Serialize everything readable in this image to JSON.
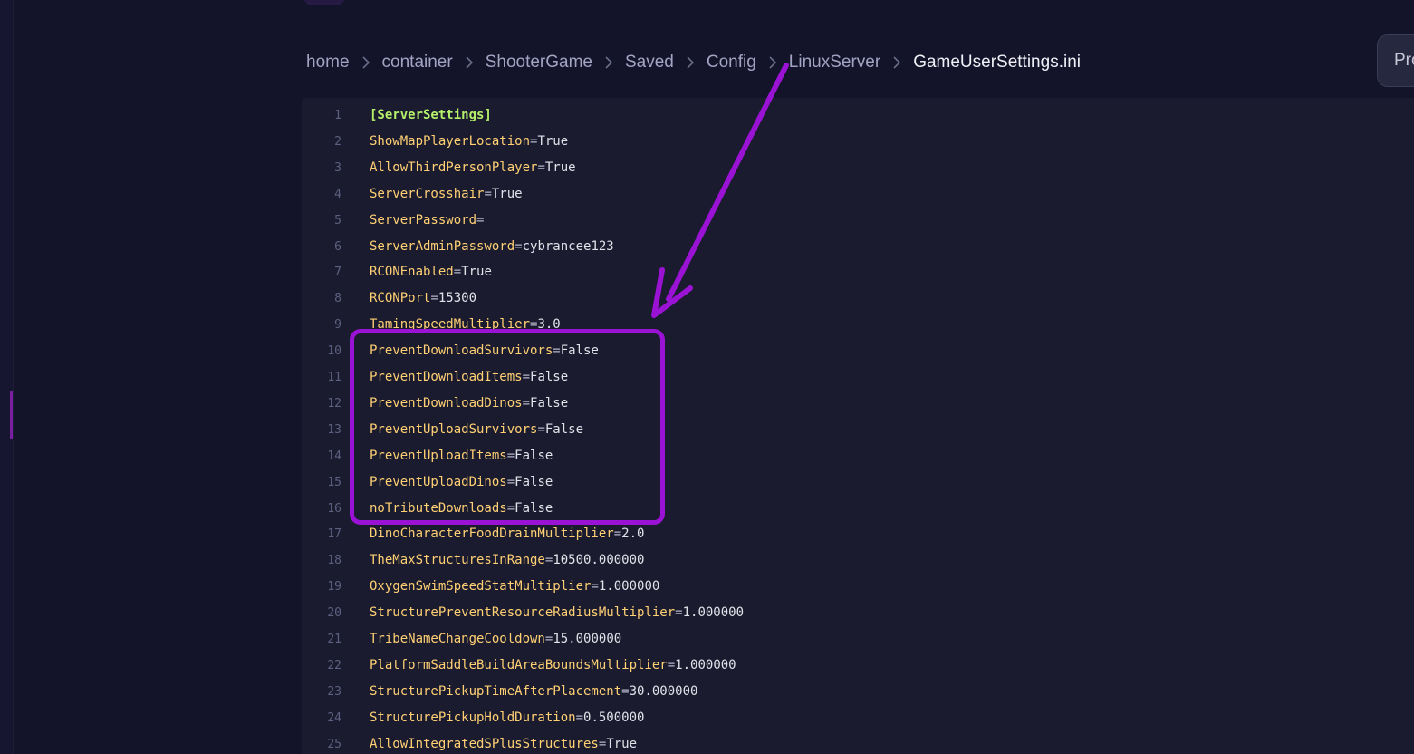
{
  "breadcrumb": {
    "items": [
      "home",
      "container",
      "ShooterGame",
      "Saved",
      "Config",
      "LinuxServer"
    ],
    "current": "GameUserSettings.ini"
  },
  "profile_button": {
    "label": "Pro"
  },
  "editor": {
    "lines": [
      {
        "n": "1",
        "section": "[ServerSettings]"
      },
      {
        "n": "2",
        "key": "ShowMapPlayerLocation",
        "value": "True"
      },
      {
        "n": "3",
        "key": "AllowThirdPersonPlayer",
        "value": "True"
      },
      {
        "n": "4",
        "key": "ServerCrosshair",
        "value": "True"
      },
      {
        "n": "5",
        "key": "ServerPassword",
        "value": ""
      },
      {
        "n": "6",
        "key": "ServerAdminPassword",
        "value": "cybrancee123"
      },
      {
        "n": "7",
        "key": "RCONEnabled",
        "value": "True"
      },
      {
        "n": "8",
        "key": "RCONPort",
        "value": "15300"
      },
      {
        "n": "9",
        "key": "TamingSpeedMultiplier",
        "value": "3.0"
      },
      {
        "n": "10",
        "key": "PreventDownloadSurvivors",
        "value": "False"
      },
      {
        "n": "11",
        "key": "PreventDownloadItems",
        "value": "False"
      },
      {
        "n": "12",
        "key": "PreventDownloadDinos",
        "value": "False"
      },
      {
        "n": "13",
        "key": "PreventUploadSurvivors",
        "value": "False"
      },
      {
        "n": "14",
        "key": "PreventUploadItems",
        "value": "False"
      },
      {
        "n": "15",
        "key": "PreventUploadDinos",
        "value": "False"
      },
      {
        "n": "16",
        "key": "noTributeDownloads",
        "value": "False"
      },
      {
        "n": "17",
        "key": "DinoCharacterFoodDrainMultiplier",
        "value": "2.0"
      },
      {
        "n": "18",
        "key": "TheMaxStructuresInRange",
        "value": "10500.000000"
      },
      {
        "n": "19",
        "key": "OxygenSwimSpeedStatMultiplier",
        "value": "1.000000"
      },
      {
        "n": "20",
        "key": "StructurePreventResourceRadiusMultiplier",
        "value": "1.000000"
      },
      {
        "n": "21",
        "key": "TribeNameChangeCooldown",
        "value": "15.000000"
      },
      {
        "n": "22",
        "key": "PlatformSaddleBuildAreaBoundsMultiplier",
        "value": "1.000000"
      },
      {
        "n": "23",
        "key": "StructurePickupTimeAfterPlacement",
        "value": "30.000000"
      },
      {
        "n": "24",
        "key": "StructurePickupHoldDuration",
        "value": "0.500000"
      },
      {
        "n": "25",
        "key": "AllowIntegratedSPlusStructures",
        "value": "True"
      }
    ]
  },
  "colors": {
    "background": "#13132a",
    "editor_bg": "#1a1b2e",
    "key": "#ffd074",
    "section": "#b5f06a",
    "annotation": "#9a12d4"
  },
  "annotation": {
    "highlighted_lines": [
      "10",
      "16"
    ],
    "arrow_icon": "arrow-down-left-icon"
  }
}
